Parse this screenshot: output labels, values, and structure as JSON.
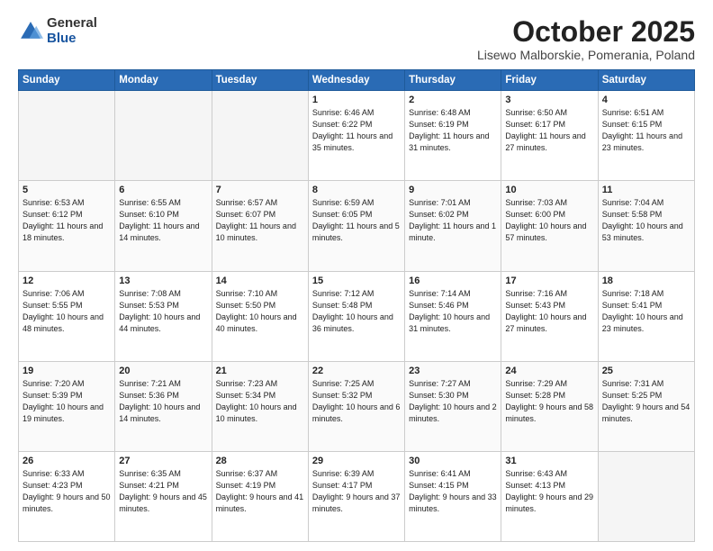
{
  "logo": {
    "general": "General",
    "blue": "Blue"
  },
  "title": "October 2025",
  "location": "Lisewo Malborskie, Pomerania, Poland",
  "days_of_week": [
    "Sunday",
    "Monday",
    "Tuesday",
    "Wednesday",
    "Thursday",
    "Friday",
    "Saturday"
  ],
  "weeks": [
    [
      {
        "day": "",
        "detail": ""
      },
      {
        "day": "",
        "detail": ""
      },
      {
        "day": "",
        "detail": ""
      },
      {
        "day": "1",
        "detail": "Sunrise: 6:46 AM\nSunset: 6:22 PM\nDaylight: 11 hours\nand 35 minutes."
      },
      {
        "day": "2",
        "detail": "Sunrise: 6:48 AM\nSunset: 6:19 PM\nDaylight: 11 hours\nand 31 minutes."
      },
      {
        "day": "3",
        "detail": "Sunrise: 6:50 AM\nSunset: 6:17 PM\nDaylight: 11 hours\nand 27 minutes."
      },
      {
        "day": "4",
        "detail": "Sunrise: 6:51 AM\nSunset: 6:15 PM\nDaylight: 11 hours\nand 23 minutes."
      }
    ],
    [
      {
        "day": "5",
        "detail": "Sunrise: 6:53 AM\nSunset: 6:12 PM\nDaylight: 11 hours\nand 18 minutes."
      },
      {
        "day": "6",
        "detail": "Sunrise: 6:55 AM\nSunset: 6:10 PM\nDaylight: 11 hours\nand 14 minutes."
      },
      {
        "day": "7",
        "detail": "Sunrise: 6:57 AM\nSunset: 6:07 PM\nDaylight: 11 hours\nand 10 minutes."
      },
      {
        "day": "8",
        "detail": "Sunrise: 6:59 AM\nSunset: 6:05 PM\nDaylight: 11 hours\nand 5 minutes."
      },
      {
        "day": "9",
        "detail": "Sunrise: 7:01 AM\nSunset: 6:02 PM\nDaylight: 11 hours\nand 1 minute."
      },
      {
        "day": "10",
        "detail": "Sunrise: 7:03 AM\nSunset: 6:00 PM\nDaylight: 10 hours\nand 57 minutes."
      },
      {
        "day": "11",
        "detail": "Sunrise: 7:04 AM\nSunset: 5:58 PM\nDaylight: 10 hours\nand 53 minutes."
      }
    ],
    [
      {
        "day": "12",
        "detail": "Sunrise: 7:06 AM\nSunset: 5:55 PM\nDaylight: 10 hours\nand 48 minutes."
      },
      {
        "day": "13",
        "detail": "Sunrise: 7:08 AM\nSunset: 5:53 PM\nDaylight: 10 hours\nand 44 minutes."
      },
      {
        "day": "14",
        "detail": "Sunrise: 7:10 AM\nSunset: 5:50 PM\nDaylight: 10 hours\nand 40 minutes."
      },
      {
        "day": "15",
        "detail": "Sunrise: 7:12 AM\nSunset: 5:48 PM\nDaylight: 10 hours\nand 36 minutes."
      },
      {
        "day": "16",
        "detail": "Sunrise: 7:14 AM\nSunset: 5:46 PM\nDaylight: 10 hours\nand 31 minutes."
      },
      {
        "day": "17",
        "detail": "Sunrise: 7:16 AM\nSunset: 5:43 PM\nDaylight: 10 hours\nand 27 minutes."
      },
      {
        "day": "18",
        "detail": "Sunrise: 7:18 AM\nSunset: 5:41 PM\nDaylight: 10 hours\nand 23 minutes."
      }
    ],
    [
      {
        "day": "19",
        "detail": "Sunrise: 7:20 AM\nSunset: 5:39 PM\nDaylight: 10 hours\nand 19 minutes."
      },
      {
        "day": "20",
        "detail": "Sunrise: 7:21 AM\nSunset: 5:36 PM\nDaylight: 10 hours\nand 14 minutes."
      },
      {
        "day": "21",
        "detail": "Sunrise: 7:23 AM\nSunset: 5:34 PM\nDaylight: 10 hours\nand 10 minutes."
      },
      {
        "day": "22",
        "detail": "Sunrise: 7:25 AM\nSunset: 5:32 PM\nDaylight: 10 hours\nand 6 minutes."
      },
      {
        "day": "23",
        "detail": "Sunrise: 7:27 AM\nSunset: 5:30 PM\nDaylight: 10 hours\nand 2 minutes."
      },
      {
        "day": "24",
        "detail": "Sunrise: 7:29 AM\nSunset: 5:28 PM\nDaylight: 9 hours\nand 58 minutes."
      },
      {
        "day": "25",
        "detail": "Sunrise: 7:31 AM\nSunset: 5:25 PM\nDaylight: 9 hours\nand 54 minutes."
      }
    ],
    [
      {
        "day": "26",
        "detail": "Sunrise: 6:33 AM\nSunset: 4:23 PM\nDaylight: 9 hours\nand 50 minutes."
      },
      {
        "day": "27",
        "detail": "Sunrise: 6:35 AM\nSunset: 4:21 PM\nDaylight: 9 hours\nand 45 minutes."
      },
      {
        "day": "28",
        "detail": "Sunrise: 6:37 AM\nSunset: 4:19 PM\nDaylight: 9 hours\nand 41 minutes."
      },
      {
        "day": "29",
        "detail": "Sunrise: 6:39 AM\nSunset: 4:17 PM\nDaylight: 9 hours\nand 37 minutes."
      },
      {
        "day": "30",
        "detail": "Sunrise: 6:41 AM\nSunset: 4:15 PM\nDaylight: 9 hours\nand 33 minutes."
      },
      {
        "day": "31",
        "detail": "Sunrise: 6:43 AM\nSunset: 4:13 PM\nDaylight: 9 hours\nand 29 minutes."
      },
      {
        "day": "",
        "detail": ""
      }
    ]
  ]
}
